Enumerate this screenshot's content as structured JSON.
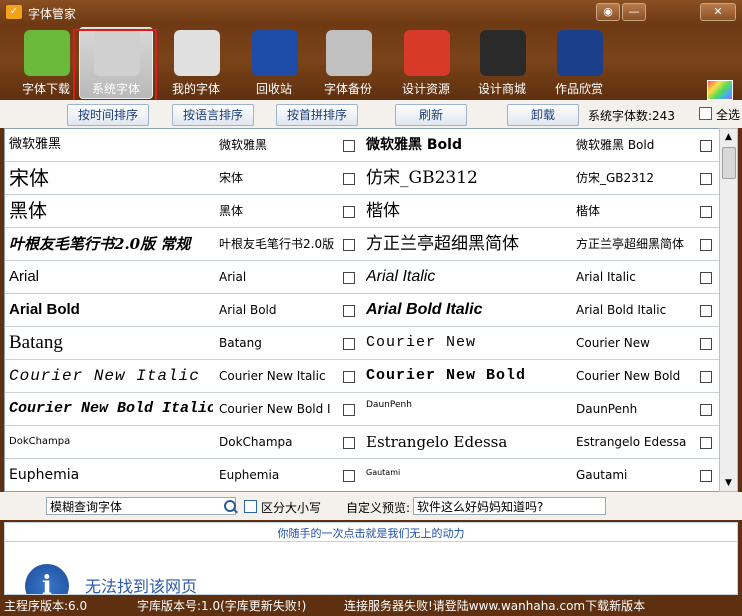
{
  "window": {
    "title": "字体管家",
    "controls": [
      "◉",
      "—",
      "✕"
    ]
  },
  "toolbar": {
    "items": [
      {
        "label": "字体下载",
        "icon": "download-arrow-icon",
        "color": "#6ab93a"
      },
      {
        "label": "系统字体",
        "icon": "monitor-wand-icon",
        "color": "#d0d0d0"
      },
      {
        "label": "我的字体",
        "icon": "colored-folders-icon",
        "color": "#e0e0e0"
      },
      {
        "label": "回收站",
        "icon": "recycle-bin-icon",
        "color": "#1e4da8"
      },
      {
        "label": "字体备份",
        "icon": "cd-disc-icon",
        "color": "#c0c0c0"
      },
      {
        "label": "设计资源",
        "icon": "house-icon",
        "color": "#d83a2a"
      },
      {
        "label": "设计商城",
        "icon": "tmall-cat-icon",
        "color": "#2a2a2a"
      },
      {
        "label": "作品欣赏",
        "icon": "photoshop-ps-icon",
        "color": "#1b3f8a"
      }
    ],
    "selected": "系统字体",
    "highlight_color": "#e01b1b"
  },
  "sortbar": {
    "by_time": "按时间排序",
    "by_language": "按语言排序",
    "by_pinyin": "按首拼排序",
    "refresh": "刷新",
    "uninstall": "卸载",
    "count_label": "系统字体数:243",
    "select_all": "全选"
  },
  "fonts": [
    {
      "left_sample": "微软雅黑",
      "left_name": "微软雅黑",
      "right_sample": "微软雅黑 Bold",
      "right_name": "微软雅黑 Bold"
    },
    {
      "left_sample": "宋体",
      "left_name": "宋体",
      "right_sample": "仿宋_GB2312",
      "right_name": "仿宋_GB2312"
    },
    {
      "left_sample": "黑体",
      "left_name": "黑体",
      "right_sample": "楷体",
      "right_name": "楷体"
    },
    {
      "left_sample": "叶根友毛笔行书2.0版 常规",
      "left_name": "叶根友毛笔行书2.0版",
      "right_sample": "方正兰亭超细黑简体",
      "right_name": "方正兰亭超细黑简体"
    },
    {
      "left_sample": "Arial",
      "left_name": "Arial",
      "right_sample": "Arial Italic",
      "right_name": "Arial Italic"
    },
    {
      "left_sample": "Arial Bold",
      "left_name": "Arial Bold",
      "right_sample": "Arial Bold Italic",
      "right_name": "Arial Bold Italic"
    },
    {
      "left_sample": "Batang",
      "left_name": "Batang",
      "right_sample": "Courier New",
      "right_name": "Courier New"
    },
    {
      "left_sample": "Courier New Italic",
      "left_name": "Courier New Italic",
      "right_sample": "Courier New Bold",
      "right_name": "Courier New Bold"
    },
    {
      "left_sample": "Courier New Bold Italic",
      "left_name": "Courier New Bold I",
      "right_sample": "DaunPenh",
      "right_name": "DaunPenh"
    },
    {
      "left_sample": "DokChampa",
      "left_name": "DokChampa",
      "right_sample": "Estrangelo Edessa",
      "right_name": "Estrangelo Edessa"
    },
    {
      "left_sample": "Euphemia",
      "left_name": "Euphemia",
      "right_sample": "Gautami",
      "right_name": "Gautami"
    }
  ],
  "search": {
    "value": "模糊查询字体",
    "case_label": "区分大小写",
    "preview_label": "自定义预览:",
    "preview_value": "软件这么好妈妈知道吗?"
  },
  "slogan": "你随手的一次点击就是我们无上的动力",
  "web": {
    "message": "无法找到该网页"
  },
  "status": {
    "version": "主程序版本:6.0",
    "library": "字库版本号:1.0(字库更新失败!)",
    "connection": "连接服务器失败!请登陆www.wanhaha.com下载新版本"
  }
}
